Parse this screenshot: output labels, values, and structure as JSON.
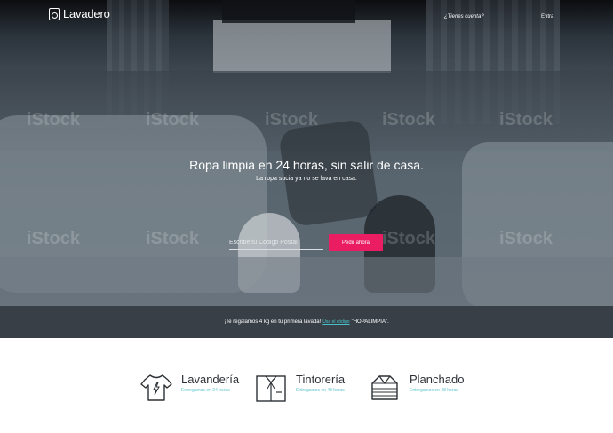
{
  "header": {
    "brand": "Lavadero",
    "account_link": "¿Tienes cuenta?",
    "login_link": "Entra"
  },
  "hero": {
    "headline": "Ropa limpia en 24 horas, sin salir de casa.",
    "subline": "La ropa sucia ya no se lava en casa.",
    "zip_placeholder": "Escribe tu Código Postal",
    "cta_label": "Pedir ahora",
    "watermark": "iStock"
  },
  "promo": {
    "text_before": "¡Te regalamos 4 kg en tu primera lavada!",
    "link_text": "Usa el código",
    "code": "\"HOPALIMPIA\"."
  },
  "services": [
    {
      "title": "Lavandería",
      "subtitle": "Entregamos en 24 horas",
      "icon": "tshirt-icon"
    },
    {
      "title": "Tintorería",
      "subtitle": "Entregamos en 48 horas",
      "icon": "shirt-icon"
    },
    {
      "title": "Planchado",
      "subtitle": "Entregamos en 48 horas",
      "icon": "folded-clothes-icon"
    }
  ],
  "colors": {
    "accent": "#ea1d63",
    "link": "#5bc3cc",
    "promo_bg": "#383f46"
  }
}
